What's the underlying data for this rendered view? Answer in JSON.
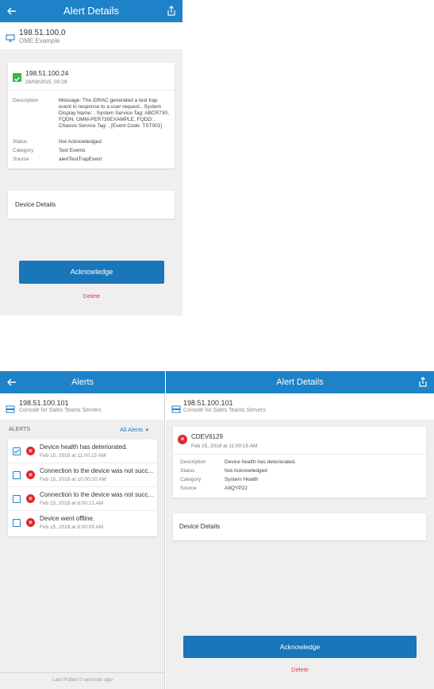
{
  "phone": {
    "header_title": "Alert Details",
    "device": {
      "ip": "198.51.100.0",
      "name": "OME Example"
    },
    "alert": {
      "ip": "198.51.100.24",
      "datetime": "29/09/2015, 00:29",
      "description_label": "Description",
      "description_lines": [
        "Message: The iDRAC generated a test trap",
        "event in response to a user request., System",
        "Display Name: , System Service Tag: ABCR730,",
        "FQDN: OMM-PER730EXAMPLE, FQDD: ,",
        "Chassis Service Tag: , [Event Code: TST001]"
      ],
      "status_label": "Status",
      "status_value": "Not Acknowledged",
      "category_label": "Category",
      "category_value": "Test Events",
      "source_label": "Source",
      "source_value": "alertTestTrapEvent"
    },
    "device_details_label": "Device Details",
    "acknowledge_label": "Acknowledge",
    "delete_label": "Delete"
  },
  "tablet": {
    "left_header_title": "Alerts",
    "right_header_title": "Alert Details",
    "left_device": {
      "ip": "198.51.100.101",
      "name": "Console for Sales Teams Servers"
    },
    "right_device": {
      "ip": "198.51.100.101",
      "name": "Console for Sales Teams Servers"
    },
    "alerts_section_label": "ALERTS",
    "filter_label": "All Alerts",
    "alerts": [
      {
        "title": "Device health has deteriorated.",
        "date": "Feb 15, 2018 at 11:00:15 AM",
        "checked": true
      },
      {
        "title": "Connection to the device was not succ...",
        "date": "Feb 15, 2018 at 10:00:20 AM",
        "checked": false
      },
      {
        "title": "Connection to the device was not succ...",
        "date": "Feb 15, 2018 at 6:00:21 AM",
        "checked": false
      },
      {
        "title": "Device went offline.",
        "date": "Feb 15, 2018 at 6:00:09 AM",
        "checked": false
      }
    ],
    "last_polled": "Last Polled 0 seconds ago",
    "detail": {
      "code": "CDEV6129",
      "datetime": "Feb 15, 2018 at 11:00:15 AM",
      "description_label": "Description",
      "description_value": "Device health has deteriorated.",
      "status_label": "Status",
      "status_value": "Not Acknowledged",
      "category_label": "Category",
      "category_value": "System Health",
      "source_label": "Source",
      "source_value": "A9QYP22"
    },
    "device_details_label": "Device Details",
    "acknowledge_label": "Acknowledge",
    "delete_label": "Delete"
  },
  "colors": {
    "brand_blue": "#1e82c8",
    "button_blue": "#1976b8",
    "error_red": "#d92c35",
    "delete_red": "#e03a4a",
    "success_green": "#3cb44a"
  }
}
